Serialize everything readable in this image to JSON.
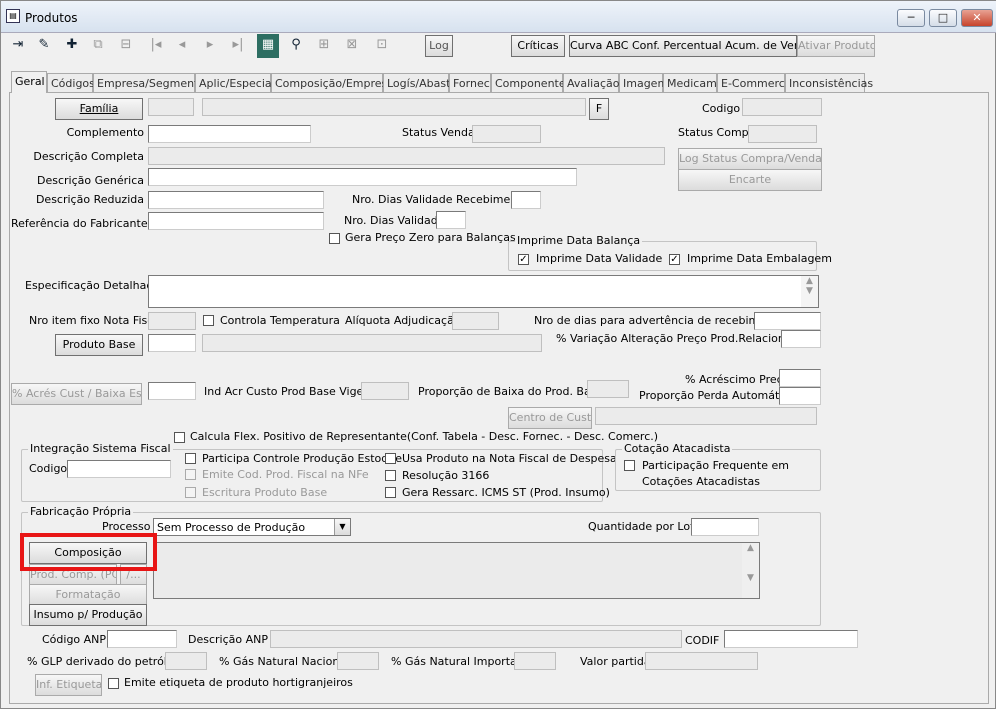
{
  "window": {
    "title": "Produtos",
    "minimize": "─",
    "maximize": "□",
    "close": "✕"
  },
  "toolbar": {
    "log": "Log",
    "criticas": "Críticas",
    "curva_abc": "Curva ABC Conf. Percentual Acum. de Venda",
    "ativar_produto": "Ativar Produto",
    "icons": [
      "exit-icon",
      "eraser-icon",
      "new-record-icon",
      "copy-icon",
      "split-icon",
      "first-icon",
      "previous-icon",
      "next-icon",
      "last-icon",
      "grid-icon",
      "search-icon",
      "tree-icon",
      "tree-move-icon",
      "network-icon"
    ]
  },
  "tabs": [
    "Geral",
    "Códigos",
    "Empresa/Segmento",
    "Aplic/Especial",
    "Composição/Empresa",
    "Logís/Abast",
    "Fornec",
    "Componentes",
    "Avaliação",
    "Imagem",
    "Medicam.",
    "E-Commerce",
    "Inconsistências"
  ],
  "form": {
    "familia_btn": "Família",
    "f_btn": "F",
    "codigo": "Codigo",
    "complemento": "Complemento",
    "status_venda": "Status Venda",
    "status_compra": "Status Compra",
    "descricao_completa": "Descrição Completa",
    "log_status": "Log Status Compra/Venda",
    "descricao_generica": "Descrição Genérica",
    "encarte": "Encarte",
    "descricao_reduzida": "Descrição Reduzida",
    "nro_dias_validade_receb": "Nro. Dias Validade Recebimento",
    "referencia_fabricante": "Referência do Fabricante",
    "nro_dias_validade": "Nro. Dias Validade",
    "gera_preco_zero": "Gera Preço Zero para Balanças",
    "imprime_data_balanca": "Imprime Data Balança",
    "imprime_data_validade": "Imprime Data Validade",
    "imprime_data_embalagem": "Imprime Data Embalagem",
    "especificacao_detalhada": "Especificação Detalhada",
    "nro_item_fixo": "Nro item fixo Nota Fiscal",
    "controla_temperatura": "Controla Temperatura",
    "aliquota_adjudicacao": "Alíquota Adjudicação",
    "nro_dias_advertencia": "Nro de dias para advertência de recebimento",
    "produto_base_btn": "Produto Base",
    "variacao_alteracao": "% Variação Alteração Preço Prod.Relacionado",
    "acres_cust_btn": "% Acrés Cust / Baixa Estq",
    "ind_acr_custo": "Ind Acr Custo Prod Base Vigente",
    "proporcao_baixa": "Proporção de Baixa do Prod. Base",
    "acrescimo_preco": "% Acréscimo Preço",
    "proporcao_perda": "Proporção Perda Automática",
    "centro_custo_btn": "Centro de Custo",
    "calcula_flex": "Calcula Flex. Positivo de Representante(Conf. Tabela - Desc. Fornec. - Desc. Comerc.)"
  },
  "integracao": {
    "title": "Integração Sistema Fiscal",
    "codigo": "Codigo",
    "participa_controle": "Participa Controle Produção Estoque",
    "emite_cod": "Emite Cod. Prod. Fiscal na NFe",
    "escritura": "Escritura Produto Base",
    "usa_produto": "Usa Produto na Nota Fiscal de Despesa",
    "resolucao": "Resolução 3166",
    "gera_ressarc": "Gera Ressarc. ICMS ST (Prod. Insumo)"
  },
  "cotacao": {
    "title": "Cotação Atacadista",
    "participacao_1": "Participação Frequente em",
    "participacao_2": "Cotações Atacadistas"
  },
  "fabricacao": {
    "title": "Fabricação Própria",
    "processo": "Processo",
    "processo_value": "Sem Processo de Produção",
    "quantidade_lote": "Quantidade por Lote",
    "composicao_btn": "Composição",
    "prod_comp_btn": "Prod. Comp. (PC)",
    "edit_btn": "/...",
    "formatacao_btn": "Formatação",
    "insumo_btn": "Insumo p/ Produção"
  },
  "footer": {
    "codigo_anp": "Código ANP",
    "descricao_anp": "Descrição ANP",
    "codif": "CODIF",
    "glp": "% GLP derivado do petróleo",
    "gas_nacional": "% Gás Natural Nacional",
    "gas_importado": "% Gás Natural Importado",
    "valor_partida": "Valor partida",
    "inf_etiqueta_btn": "Inf. Etiqueta",
    "emite_etiqueta": "Emite etiqueta de produto hortigranjeiros"
  },
  "checks": {
    "imprime_data_validade": "✓",
    "imprime_data_embalagem": "✓"
  },
  "colors": {
    "highlight": "#e81515"
  }
}
